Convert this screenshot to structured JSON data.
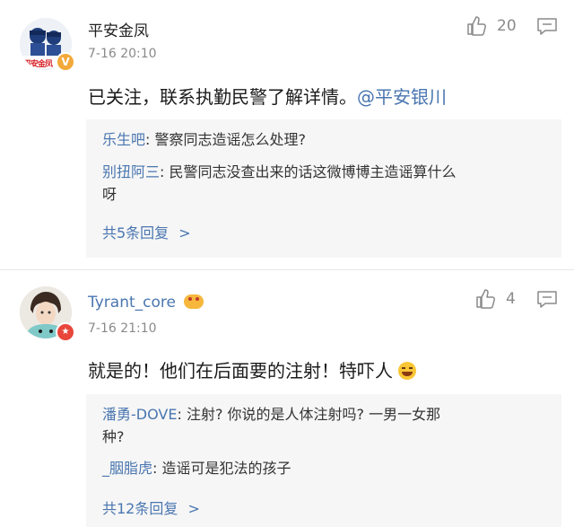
{
  "comments": [
    {
      "author": "平安金凤",
      "time": "7-16 20:10",
      "like_count": "20",
      "text": "已关注，联系执勤民警了解详情。",
      "mention": "@平安银川",
      "badge": "verified-v",
      "avatar_logo": "平安金凤",
      "replies": [
        {
          "name": "乐生吧",
          "text": "警察同志造谣怎么处理?"
        },
        {
          "name": "别扭阿三",
          "text": "民警同志没查出来的话这微博博主造谣算什么",
          "text2": "呀"
        }
      ],
      "more_replies": "共5条回复"
    },
    {
      "author": "Tyrant_core",
      "time": "7-16 21:10",
      "like_count": "4",
      "text": "就是的！他们在后面要的注射！特吓人",
      "badge": "red-badge",
      "replies": [
        {
          "name": "潘勇-DOVE",
          "text": "注射? 你说的是人体注射吗? 一男一女那",
          "text2": "种?"
        },
        {
          "name": "_胭脂虎",
          "text": "造谣可是犯法的孩子"
        }
      ],
      "more_replies": "共12条回复"
    }
  ],
  "colors": {
    "link": "#4a76b0",
    "meta": "#8a8a8a",
    "reply_bg": "#f6f6f6",
    "badge_verified": "#f3a93a",
    "badge_red": "#e8463b"
  }
}
